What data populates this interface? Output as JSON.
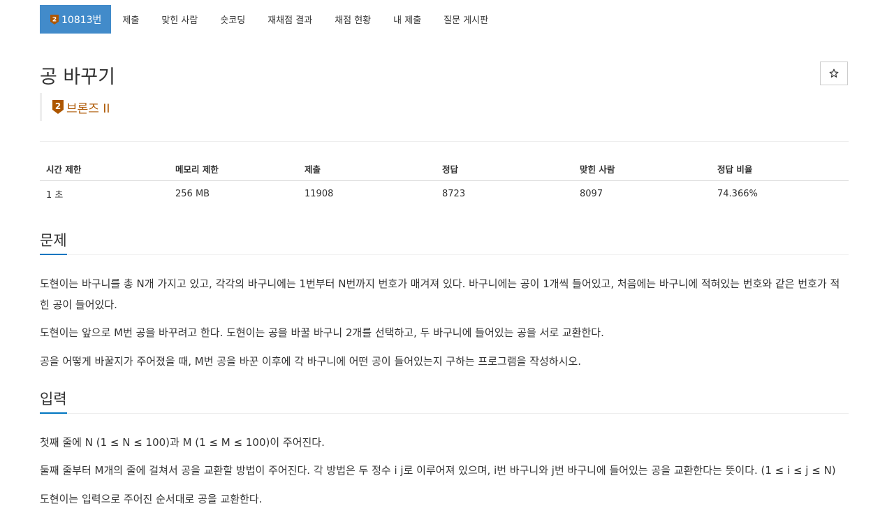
{
  "nav": {
    "problem_id": "10813번",
    "items": [
      "제출",
      "맞힌 사람",
      "숏코딩",
      "재채점 결과",
      "채점 현황",
      "내 제출",
      "질문 게시판"
    ]
  },
  "problem": {
    "title": "공 바꾸기",
    "tier": {
      "level": "2",
      "label": "브론즈 II",
      "color": "#ad5600"
    },
    "star_icon": "star-outline-icon"
  },
  "info": {
    "headers": [
      "시간 제한",
      "메모리 제한",
      "제출",
      "정답",
      "맞힌 사람",
      "정답 비율"
    ],
    "values": [
      "1 초",
      "256 MB",
      "11908",
      "8723",
      "8097",
      "74.366%"
    ]
  },
  "sections": {
    "description": {
      "title": "문제",
      "paragraphs": [
        "도현이는 바구니를 총 N개 가지고 있고, 각각의 바구니에는 1번부터 N번까지 번호가 매겨져 있다. 바구니에는 공이 1개씩 들어있고, 처음에는 바구니에 적혀있는 번호와 같은 번호가 적힌 공이 들어있다.",
        "도현이는 앞으로 M번 공을 바꾸려고 한다. 도현이는 공을 바꿀 바구니 2개를 선택하고, 두 바구니에 들어있는 공을 서로 교환한다.",
        "공을 어떻게 바꿀지가 주어졌을 때, M번 공을 바꾼 이후에 각 바구니에 어떤 공이 들어있는지 구하는 프로그램을 작성하시오."
      ]
    },
    "input": {
      "title": "입력",
      "paragraphs": [
        "첫째 줄에 N (1 ≤ N ≤ 100)과 M (1 ≤ M ≤ 100)이 주어진다.",
        "둘째 줄부터 M개의 줄에 걸쳐서 공을 교환할 방법이 주어진다. 각 방법은 두 정수 i j로 이루어져 있으며, i번 바구니와 j번 바구니에 들어있는 공을 교환한다는 뜻이다. (1 ≤ i ≤ j ≤ N)",
        "도현이는 입력으로 주어진 순서대로 공을 교환한다."
      ]
    }
  }
}
